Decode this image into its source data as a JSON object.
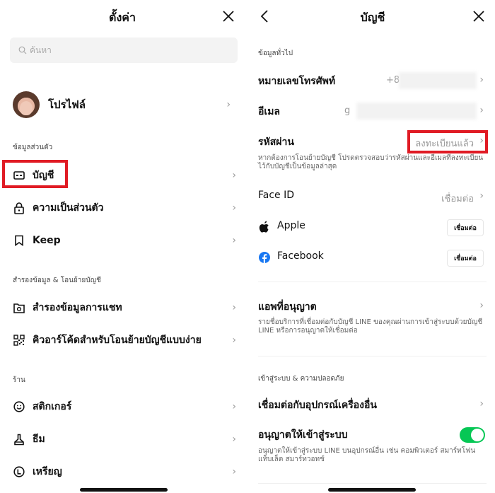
{
  "left": {
    "header": {
      "title": "ตั้งค่า"
    },
    "search": {
      "placeholder": "ค้นหา"
    },
    "profile": {
      "label": "โปรไฟล์"
    },
    "sections": [
      {
        "label": "ข้อมูลส่วนตัว",
        "items": [
          {
            "label": "บัญชี",
            "icon": "id-card-icon"
          },
          {
            "label": "ความเป็นส่วนตัว",
            "icon": "lock-icon"
          },
          {
            "label": "Keep",
            "icon": "bookmark-icon"
          }
        ]
      },
      {
        "label": "สำรองข้อมูล & โอนย้ายบัญชี",
        "items": [
          {
            "label": "สำรองข้อมูลการแชท",
            "icon": "backup-folder-icon"
          },
          {
            "label": "คิวอาร์โค้ดสำหรับโอนย้ายบัญชีแบบง่าย",
            "icon": "qr-code-icon"
          }
        ]
      },
      {
        "label": "ร้าน",
        "items": [
          {
            "label": "สติกเกอร์",
            "icon": "smiley-icon"
          },
          {
            "label": "ธีม",
            "icon": "theme-brush-icon"
          },
          {
            "label": "เหรียญ",
            "icon": "coin-icon"
          }
        ]
      }
    ]
  },
  "right": {
    "header": {
      "title": "บัญชี"
    },
    "general_section": "ข้อมูลทั่วไป",
    "phone": {
      "label": "หมายเลขโทรศัพท์",
      "value": "+8"
    },
    "email": {
      "label": "อีเมล",
      "value": "g"
    },
    "password": {
      "label": "รหัสผ่าน",
      "value": "ลงทะเบียนแล้ว",
      "desc": "หากต้องการโอนย้ายบัญชี โปรดตรวจสอบว่ารหัสผ่านและอีเมลที่ลงทะเบียนไว้กับบัญชีเป็นข้อมูลล่าสุด"
    },
    "face_id": {
      "label": "Face ID",
      "value": "เชื่อมต่อ"
    },
    "apple": {
      "label": "Apple",
      "button": "เชื่อมต่อ"
    },
    "facebook": {
      "label": "Facebook",
      "button": "เชื่อมต่อ"
    },
    "authorized_apps": {
      "label": "แอพที่อนุญาต",
      "desc": "รายชื่อบริการที่เชื่อมต่อกับบัญชี LINE ของคุณผ่านการเข้าสู่ระบบด้วยบัญชี LINE หรือการอนุญาตให้เชื่อมต่อ"
    },
    "security_section": "เข้าสู่ระบบ & ความปลอดภัย",
    "other_devices": {
      "label": "เชื่อมต่อกับอุปกรณ์เครื่องอื่น"
    },
    "allow_login": {
      "label": "อนุญาตให้เข้าสู่ระบบ",
      "enabled": true,
      "desc": "อนุญาตให้เข้าสู่ระบบ LINE บนอุปกรณ์อื่น เช่น คอมพิวเตอร์ สมาร์ทโฟน แท็บเล็ต สมาร์ทวอทช์"
    },
    "toggle_color": "#06c755"
  },
  "highlight_color": "#e01b24",
  "chevron": "›"
}
